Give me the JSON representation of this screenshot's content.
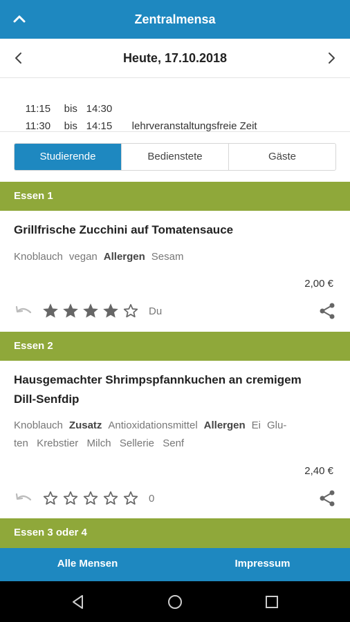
{
  "header": {
    "title": "Zentralmensa"
  },
  "date": {
    "label": "Heute, 17.10.2018"
  },
  "hours": [
    {
      "from": "11:15",
      "bis": "bis",
      "to": "14:30",
      "note": ""
    },
    {
      "from": "11:30",
      "bis": "bis",
      "to": "14:15",
      "note": "lehrveranstaltungsfreie Zeit"
    }
  ],
  "tabs": [
    "Studierende",
    "Bedienstete",
    "Gäste"
  ],
  "sections": {
    "essen1": "Essen 1",
    "essen2": "Essen 2",
    "essen3": "Essen 3 oder 4"
  },
  "meals": [
    {
      "title": "Grillfrische Zucchini auf Tomatensauce",
      "tags_line1": [
        "Knoblauch",
        "vegan"
      ],
      "bold1": "Allergen",
      "tags_line1_after": "Sesam",
      "price": "2,00 €",
      "rating": 4,
      "rating_label": "Du"
    },
    {
      "title_line1": "Hausgemachter Shrimpspfannkuchen an cremigem",
      "title_line2": "Dill-Senfdip",
      "t1": "Knoblauch",
      "b1": "Zusatz",
      "t2": "Antioxidationsmittel",
      "b2": "Allergen",
      "t3": "Ei",
      "t4": "Glu-",
      "line2": "ten  Krebstier  Milch  Sellerie  Senf",
      "price": "2,40 €",
      "rating": 0,
      "rating_label": "0"
    }
  ],
  "bottom_nav": {
    "left": "Alle Mensen",
    "right": "Impressum"
  },
  "colors": {
    "primary": "#1e88c0",
    "section": "#8fa83a"
  }
}
